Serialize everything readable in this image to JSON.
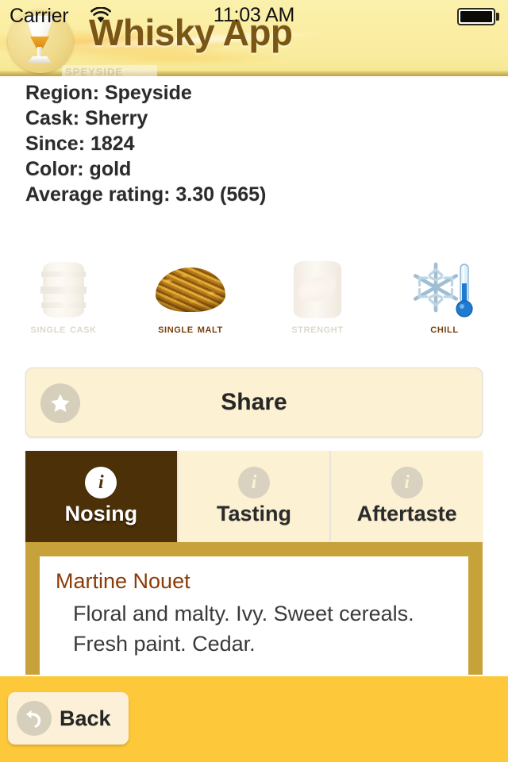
{
  "status_bar": {
    "carrier": "Carrier",
    "time": "11:03 AM",
    "wifi_icon": "wifi-icon",
    "battery_icon": "battery-full-icon"
  },
  "header": {
    "app_title": "Whisky App",
    "logo_icon": "whisky-glass-logo",
    "watermark": "SPEYSIDE"
  },
  "details": {
    "region": "Region: Speyside",
    "cask": "Cask: Sherry",
    "since": "Since: 1824",
    "color": "Color: gold",
    "rating": "Average rating: 3.30 (565)"
  },
  "attributes": [
    {
      "label": "Single Cask",
      "icon": "barrel-icon",
      "active": false
    },
    {
      "label": "Single Malt",
      "icon": "barley-grain-icon",
      "active": true
    },
    {
      "label": "Strenght",
      "icon": "strong-arm-barrel-icon",
      "active": false
    },
    {
      "label": "Chill",
      "icon": "snowflake-thermometer-icon",
      "active": true
    }
  ],
  "share": {
    "label": "Share",
    "icon": "star-icon"
  },
  "tabs": [
    {
      "label": "Nosing",
      "icon": "info-icon",
      "active": true
    },
    {
      "label": "Tasting",
      "icon": "info-icon",
      "active": false
    },
    {
      "label": "Aftertaste",
      "icon": "info-icon",
      "active": false
    }
  ],
  "note": {
    "author": "Martine Nouet",
    "body": "Floral and malty. Ivy. Sweet cereals. Fresh paint. Cedar."
  },
  "toolbar": {
    "back_label": "Back",
    "back_icon": "undo-arrow-icon"
  },
  "colors": {
    "header_yellow": "#fbeea2",
    "toolbar_yellow": "#fdc93a",
    "active_tab_brown": "#4b3008",
    "card_frame_gold": "#c7a23a",
    "cream": "#fcf1d3",
    "author_brown": "#8a3c08"
  }
}
